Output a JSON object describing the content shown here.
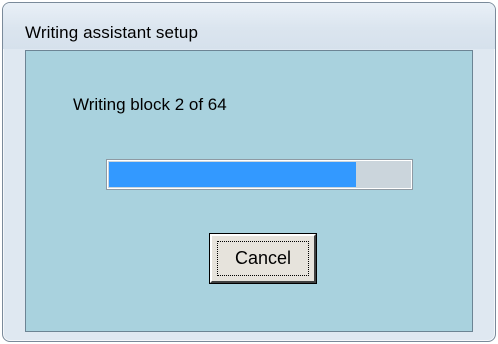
{
  "window": {
    "title": "Writing assistant setup"
  },
  "dialog": {
    "status_text": "Writing block 2 of 64",
    "progress": {
      "fraction": 0.82,
      "fill_color": "#3399ff",
      "track_color": "#cbd5dc"
    },
    "cancel_label": "Cancel",
    "background_color": "#a9d2de"
  }
}
